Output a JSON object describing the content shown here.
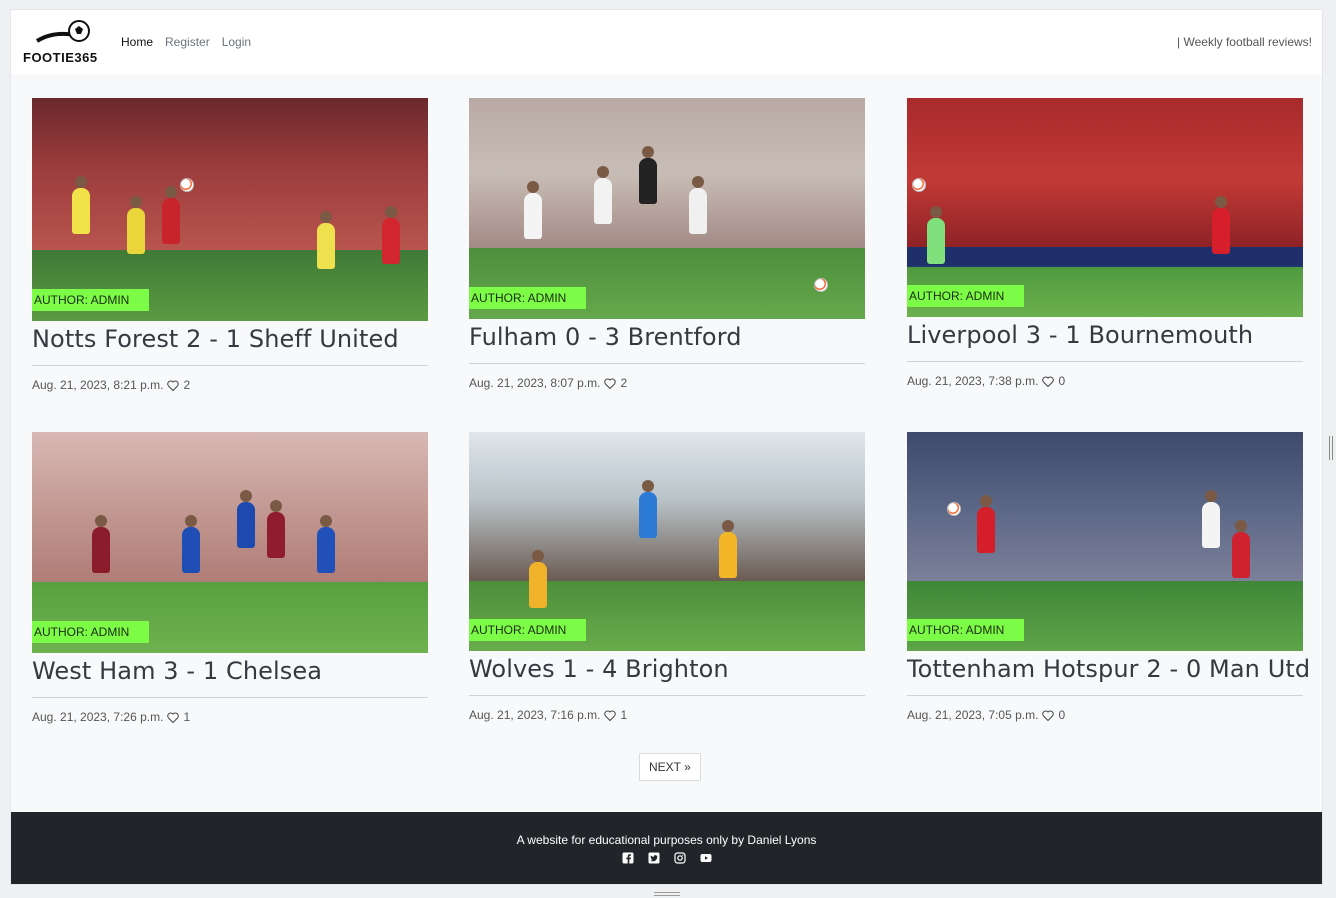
{
  "brand": {
    "name": "FOOTIE365"
  },
  "nav": {
    "links": [
      {
        "label": "Home",
        "active": true
      },
      {
        "label": "Register"
      },
      {
        "label": "Login"
      }
    ],
    "tagline": "| Weekly football reviews!"
  },
  "accent_badge_color": "#7CFC47",
  "posts": [
    {
      "title": "Notts Forest 2 - 1 Sheff United",
      "author": "AUTHOR: ADMIN",
      "date": "Aug. 21, 2023, 8:21 p.m.",
      "likes": "2"
    },
    {
      "title": "Fulham 0 - 3 Brentford",
      "author": "AUTHOR: ADMIN",
      "date": "Aug. 21, 2023, 8:07 p.m.",
      "likes": "2"
    },
    {
      "title": "Liverpool 3 - 1 Bournemouth",
      "author": "AUTHOR: ADMIN",
      "date": "Aug. 21, 2023, 7:38 p.m.",
      "likes": "0"
    },
    {
      "title": "West Ham 3 - 1 Chelsea",
      "author": "AUTHOR: ADMIN",
      "date": "Aug. 21, 2023, 7:26 p.m.",
      "likes": "1"
    },
    {
      "title": "Wolves 1 - 4 Brighton",
      "author": "AUTHOR: ADMIN",
      "date": "Aug. 21, 2023, 7:16 p.m.",
      "likes": "1"
    },
    {
      "title": "Tottenham Hotspur 2 - 0 Man Utd",
      "author": "AUTHOR: ADMIN",
      "date": "Aug. 21, 2023, 7:05 p.m.",
      "likes": "0"
    }
  ],
  "pagination": {
    "next_label": "NEXT »"
  },
  "footer": {
    "text": "A website for educational purposes only by Daniel Lyons",
    "socials": [
      "facebook-icon",
      "twitter-icon",
      "instagram-icon",
      "youtube-icon"
    ]
  }
}
